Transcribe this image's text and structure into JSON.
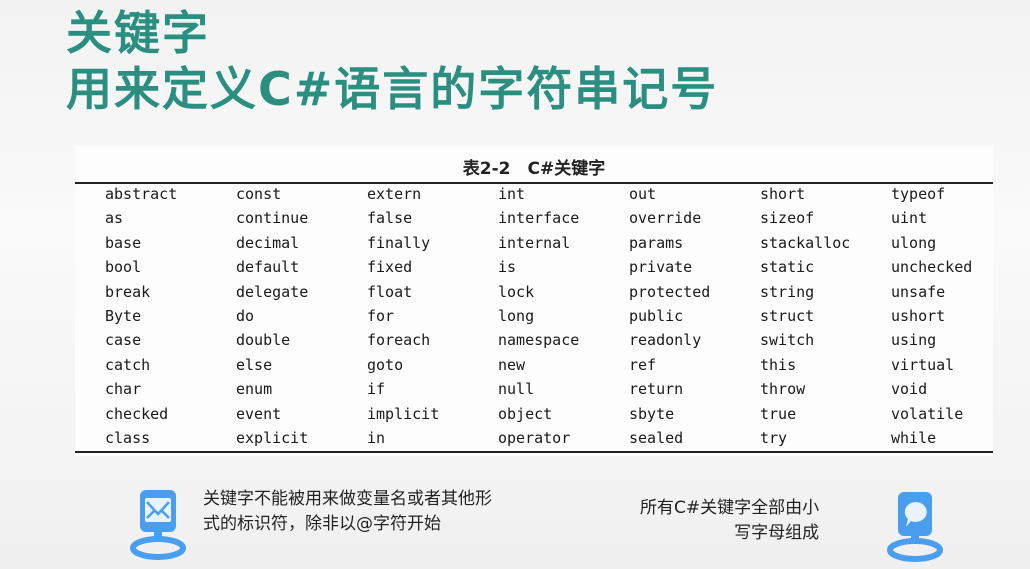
{
  "title": {
    "line1": "关键字",
    "line2": "用来定义C#语言的字符串记号"
  },
  "table": {
    "caption": "表2-2　C#关键字",
    "rows": [
      [
        "abstract",
        "const",
        "extern",
        "int",
        "out",
        "short",
        "typeof"
      ],
      [
        "as",
        "continue",
        "false",
        "interface",
        "override",
        "sizeof",
        "uint"
      ],
      [
        "base",
        "decimal",
        "finally",
        "internal",
        "params",
        "stackalloc",
        "ulong"
      ],
      [
        "bool",
        "default",
        "fixed",
        "is",
        "private",
        "static",
        "unchecked"
      ],
      [
        "break",
        "delegate",
        "float",
        "lock",
        "protected",
        "string",
        "unsafe"
      ],
      [
        "Byte",
        "do",
        "for",
        "long",
        "public",
        "struct",
        "ushort"
      ],
      [
        "case",
        "double",
        "foreach",
        "namespace",
        "readonly",
        "switch",
        "using"
      ],
      [
        "catch",
        "else",
        "goto",
        "new",
        "ref",
        "this",
        "virtual"
      ],
      [
        "char",
        "enum",
        "if",
        "null",
        "return",
        "throw",
        "void"
      ],
      [
        "checked",
        "event",
        "implicit",
        "object",
        "sbyte",
        "true",
        "volatile"
      ],
      [
        "class",
        "explicit",
        "in",
        "operator",
        "sealed",
        "try",
        "while"
      ]
    ]
  },
  "notes": {
    "left": [
      "关键字不能被用来做变量名或者其他形",
      "式的标识符，除非以@字符开始"
    ],
    "right": [
      "所有C#关键字全部由小",
      "写字母组成"
    ]
  },
  "colors": {
    "title": "#2a8f80",
    "icon": "#4a9ef0"
  }
}
